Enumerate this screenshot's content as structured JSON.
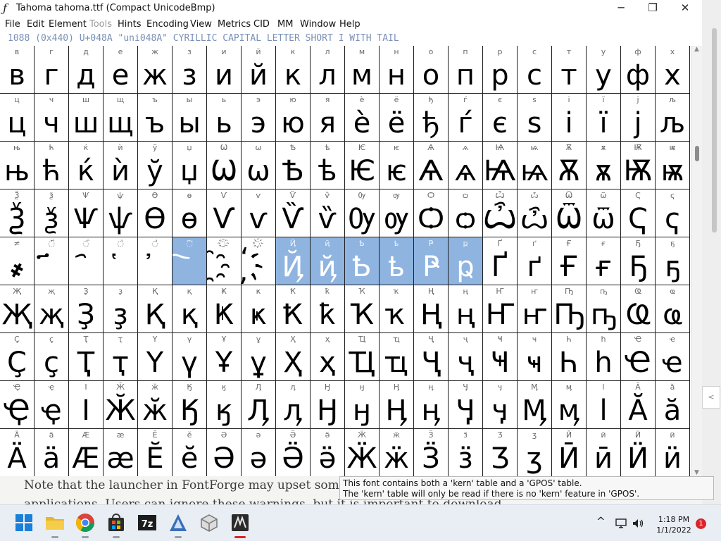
{
  "window": {
    "title": "Tahoma  tahoma.ttf (Compact UnicodeBmp)",
    "minimize": "─",
    "maximize": "❐",
    "close": "✕"
  },
  "menu": [
    "File",
    "Edit",
    "Element",
    "Tools",
    "Hints",
    "Encoding",
    "View",
    "Metrics",
    "CID",
    "MM",
    "Window",
    "Help"
  ],
  "menu_disabled": [
    "Tools"
  ],
  "info_line": "1088 (0x440) U+048A \"uni048A\" CYRILLIC CAPITAL LETTER SHORT I WITH TAIL",
  "glyph_rows": [
    {
      "labels": [
        "в",
        "г",
        "д",
        "е",
        "ж",
        "з",
        "и",
        "й",
        "к",
        "л",
        "м",
        "н",
        "о",
        "п",
        "р",
        "с",
        "т",
        "у",
        "ф",
        "х"
      ],
      "glyphs": [
        "в",
        "г",
        "д",
        "е",
        "ж",
        "з",
        "и",
        "й",
        "к",
        "л",
        "м",
        "н",
        "о",
        "п",
        "р",
        "с",
        "т",
        "у",
        "ф",
        "х"
      ]
    },
    {
      "labels": [
        "ц",
        "ч",
        "ш",
        "щ",
        "ъ",
        "ы",
        "ь",
        "э",
        "ю",
        "я",
        "ѐ",
        "ё",
        "ђ",
        "ѓ",
        "є",
        "ѕ",
        "і",
        "ї",
        "ј",
        "љ"
      ],
      "glyphs": [
        "ц",
        "ч",
        "ш",
        "щ",
        "ъ",
        "ы",
        "ь",
        "э",
        "ю",
        "я",
        "ѐ",
        "ё",
        "ђ",
        "ѓ",
        "є",
        "ѕ",
        "і",
        "ї",
        "ј",
        "љ"
      ]
    },
    {
      "labels": [
        "њ",
        "ћ",
        "ќ",
        "ѝ",
        "ў",
        "џ",
        "Ѡ",
        "ѡ",
        "Ѣ",
        "ѣ",
        "Ѥ",
        "ѥ",
        "Ѧ",
        "ѧ",
        "Ѩ",
        "ѩ",
        "Ѫ",
        "ѫ",
        "Ѭ",
        "ѭ"
      ],
      "glyphs": [
        "њ",
        "ћ",
        "ќ",
        "ѝ",
        "ў",
        "џ",
        "Ѡ",
        "ѡ",
        "Ѣ",
        "ѣ",
        "Ѥ",
        "ѥ",
        "Ѧ",
        "ѧ",
        "Ѩ",
        "ѩ",
        "Ѫ",
        "ѫ",
        "Ѭ",
        "ѭ"
      ]
    },
    {
      "labels": [
        "Ѯ",
        "ѯ",
        "Ѱ",
        "ѱ",
        "Ѳ",
        "ѳ",
        "Ѵ",
        "ѵ",
        "Ѷ",
        "ѷ",
        "Ѹ",
        "ѹ",
        "Ѻ",
        "ѻ",
        "Ѽ",
        "ѽ",
        "Ѿ",
        "ѿ",
        "Ҁ",
        "ҁ"
      ],
      "glyphs": [
        "Ѯ",
        "ѯ",
        "Ѱ",
        "ѱ",
        "Ѳ",
        "ѳ",
        "Ѵ",
        "ѵ",
        "Ѷ",
        "ѷ",
        "Ѹ",
        "ѹ",
        "Ѻ",
        "ѻ",
        "Ѽ",
        "ѽ",
        "Ѿ",
        "ѿ",
        "Ҁ",
        "ҁ"
      ]
    },
    {
      "labels": [
        "≠",
        "◌҃",
        "◌҄",
        "◌҅",
        "◌҆",
        "◌҇",
        "◌҈",
        "◌҉",
        "Ҋ",
        "ҋ",
        "Ҍ",
        "ҍ",
        "Ҏ",
        "ҏ",
        "Ґ",
        "ґ",
        "Ғ",
        "ғ",
        "Ҕ",
        "ҕ"
      ],
      "glyphs": [
        "҂",
        "҃",
        "҄",
        "҅",
        "҆",
        "҇",
        "҈",
        "҉",
        "Ҋ",
        "ҋ",
        "Ҍ",
        "ҍ",
        "Ҏ",
        "ҏ",
        "Ґ",
        "ґ",
        "Ғ",
        "ғ",
        "Ҕ",
        "ҕ"
      ]
    },
    {
      "labels": [
        "Җ",
        "җ",
        "Ҙ",
        "ҙ",
        "Қ",
        "қ",
        "Ҝ",
        "ҝ",
        "Ҟ",
        "ҟ",
        "Ҡ",
        "ҡ",
        "Ң",
        "ң",
        "Ҥ",
        "ҥ",
        "Ҧ",
        "ҧ",
        "Ҩ",
        "ҩ"
      ],
      "glyphs": [
        "Җ",
        "җ",
        "Ҙ",
        "ҙ",
        "Қ",
        "қ",
        "Ҝ",
        "ҝ",
        "Ҟ",
        "ҟ",
        "Ҡ",
        "ҡ",
        "Ң",
        "ң",
        "Ҥ",
        "ҥ",
        "Ҧ",
        "ҧ",
        "Ҩ",
        "ҩ"
      ]
    },
    {
      "labels": [
        "Ҫ",
        "ҫ",
        "Ҭ",
        "ҭ",
        "Ү",
        "ү",
        "Ұ",
        "ұ",
        "Ҳ",
        "ҳ",
        "Ҵ",
        "ҵ",
        "Ҷ",
        "ҷ",
        "Ҹ",
        "ҹ",
        "Һ",
        "һ",
        "Ҽ",
        "ҽ"
      ],
      "glyphs": [
        "Ҫ",
        "ҫ",
        "Ҭ",
        "ҭ",
        "Ү",
        "ү",
        "Ұ",
        "ұ",
        "Ҳ",
        "ҳ",
        "Ҵ",
        "ҵ",
        "Ҷ",
        "ҷ",
        "Ҹ",
        "ҹ",
        "Һ",
        "һ",
        "Ҽ",
        "ҽ"
      ]
    },
    {
      "labels": [
        "Ҿ",
        "ҿ",
        "Ӏ",
        "Ӂ",
        "ӂ",
        "Ӄ",
        "ӄ",
        "Ӆ",
        "ӆ",
        "Ӈ",
        "ӈ",
        "Ӊ",
        "ӊ",
        "Ӌ",
        "ӌ",
        "Ӎ",
        "ӎ",
        "ӏ",
        "Ӑ",
        "ӑ"
      ],
      "glyphs": [
        "Ҿ",
        "ҿ",
        "Ӏ",
        "Ӂ",
        "ӂ",
        "Ӄ",
        "ӄ",
        "Ӆ",
        "ӆ",
        "Ӈ",
        "ӈ",
        "Ӊ",
        "ӊ",
        "Ӌ",
        "ӌ",
        "Ӎ",
        "ӎ",
        "ӏ",
        "Ӑ",
        "ӑ"
      ]
    },
    {
      "labels": [
        "Ӓ",
        "ӓ",
        "Ӕ",
        "ӕ",
        "Ӗ",
        "ӗ",
        "Ә",
        "ә",
        "Ӛ",
        "ӛ",
        "Ӝ",
        "ӝ",
        "Ӟ",
        "ӟ",
        "Ӡ",
        "ӡ",
        "Ӣ",
        "ӣ",
        "Ӥ",
        "ӥ"
      ],
      "glyphs": [
        "Ӓ",
        "ӓ",
        "Ӕ",
        "ӕ",
        "Ӗ",
        "ӗ",
        "Ә",
        "ә",
        "Ӛ",
        "ӛ",
        "Ӝ",
        "ӝ",
        "Ӟ",
        "ӟ",
        "Ӡ",
        "ӡ",
        "Ӣ",
        "ӣ",
        "Ӥ",
        "ӥ"
      ]
    }
  ],
  "selected_cells": [
    [
      4,
      5
    ],
    [
      4,
      8
    ],
    [
      4,
      9
    ],
    [
      4,
      10
    ],
    [
      4,
      11
    ],
    [
      4,
      12
    ],
    [
      4,
      13
    ]
  ],
  "background_doc": {
    "line1": "Note that the launcher in FontForge may upset some a",
    "line2": "applications. Users can ignore these warnings, but it is important to download"
  },
  "tooltip": {
    "line1": "This font contains both a 'kern' table and a 'GPOS' table.",
    "line2": "  The 'kern' table will only be read if there is no 'kern' feature in 'GPOS'."
  },
  "scroll_arrows": {
    "up": "▲",
    "down": "▼"
  },
  "side_spin": "<",
  "taskbar": {
    "icons": [
      "windows-start-icon",
      "file-explorer-icon",
      "chrome-icon",
      "microsoft-store-icon",
      "7zip-icon",
      "fontforge-icon",
      "cube-app-icon",
      "fontforge-window-icon"
    ],
    "seven_zip_label": "7z",
    "tray_chevron": "^",
    "time": "1:18 PM",
    "date": "1/1/2022",
    "notifications": "1"
  },
  "colors": {
    "selection": "#8fb4e0",
    "info_text": "#7a90b8",
    "grid_line": "#1e1e1e",
    "notification_badge": "#d9252a"
  }
}
